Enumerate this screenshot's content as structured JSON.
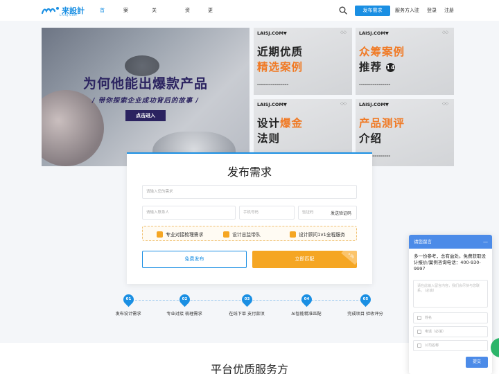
{
  "header": {
    "logo_text": "来設計",
    "logo_sub": "LAISJ.COM",
    "nav": [
      "首页",
      "案例库",
      "关于我们",
      "资讯",
      "更多"
    ],
    "publish_label": "发布需求",
    "links": [
      "服务方入驻",
      "登录",
      "注册"
    ]
  },
  "hero": {
    "title": "为何他能出爆款产品",
    "subtitle": "/ 带你探索企业成功背后的故事 /",
    "button": "点击进入"
  },
  "cards": [
    {
      "brand": "LAISJ.COM▼",
      "line1": "近期优质",
      "line2": "精选案例",
      "line1_color": "#222222",
      "line2_color": "#f07a25"
    },
    {
      "brand": "LAISJ.COM▼",
      "line1": "众筹案例",
      "line2": "推荐",
      "badge": "14",
      "line1_color": "#f07a25",
      "line2_color": "#222222"
    },
    {
      "brand": "LAISJ.COM▼",
      "line1a": "设计",
      "line1b": "爆金",
      "line2": "法则",
      "line2_color": "#222222"
    },
    {
      "brand": "LAISJ.COM▼",
      "line1": "产品测评",
      "line2": "介绍",
      "line1_color": "#f07a25",
      "line2_color": "#222222"
    }
  ],
  "form": {
    "title": "发布需求",
    "need_placeholder": "请输入您的需求",
    "contact_placeholder": "请输入联系人",
    "phone_placeholder": "手机号码",
    "code_placeholder": "验证码",
    "send_code": "发送验证码",
    "features": [
      "专业对接梳理需求",
      "设计总监带队",
      "设计顾问1v1全程服务"
    ],
    "free_btn": "免费发布",
    "match_btn": "立即匹配",
    "match_tag": "+30"
  },
  "steps": [
    {
      "num": "01",
      "label": "发布设计需求"
    },
    {
      "num": "02",
      "label": "专业对接 梳理需求"
    },
    {
      "num": "03",
      "label": "在线下单 支付款项"
    },
    {
      "num": "04",
      "label": "AI智能精准匹配"
    },
    {
      "num": "05",
      "label": "完成项目 验收评分"
    }
  ],
  "section_title": "平台优质服务方",
  "chat": {
    "title": "请您留言",
    "minimize": "—",
    "message": "多一份参考，总有益处。免费获取设计报价/案例咨询电话：400-930-9997",
    "textarea_placeholder": "请在此输入留言内容，我们会尽快与您联系。（必填）",
    "name_placeholder": "姓名",
    "phone_placeholder": "电话（必填）",
    "company_placeholder": "公司名称",
    "send": "提交"
  },
  "colors": {
    "brand": "#1a8fe3",
    "accent": "#f5a623",
    "chat": "#4c8be8"
  }
}
